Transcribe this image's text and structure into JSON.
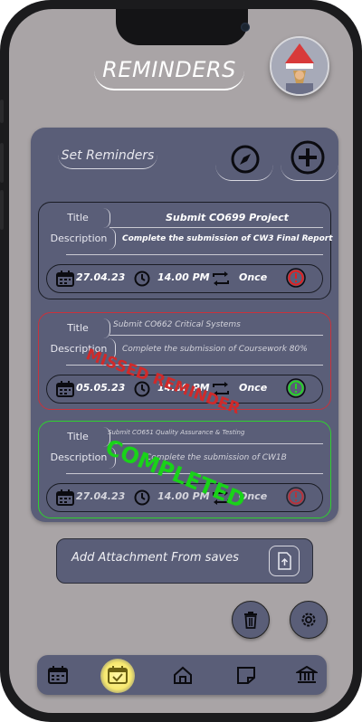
{
  "header": {
    "title": "REMINDERS"
  },
  "panel": {
    "set_reminders_label": "Set Reminders"
  },
  "reminders": [
    {
      "title_label": "Title",
      "description_label": "Description",
      "title": "Submit CO699 Project",
      "description": "Complete the submission of CW3 Final Report",
      "date": "27.04.23",
      "time": "14.00 PM",
      "repeat": "Once",
      "status": "active",
      "border_color": "#1a1c24"
    },
    {
      "title_label": "Title",
      "description_label": "Description",
      "title": "Submit CO662 Critical Systems",
      "description": "Complete the submission of Coursework 80%",
      "date": "05.05.23",
      "time": "14.00 PM",
      "repeat": "Once",
      "status": "missed",
      "stamp": "MISSED REMINDER",
      "border_color": "#c8323c"
    },
    {
      "title_label": "Title",
      "description_label": "Description",
      "title": "Submit CO651 Quality Assurance & Testing",
      "description": "Complete the submission of CW1B",
      "date": "27.04.23",
      "time": "14.00 PM",
      "repeat": "Once",
      "status": "completed",
      "stamp": "COMPLETED",
      "border_color": "#2fd12f"
    }
  ],
  "attachment": {
    "label": "Add Attachment From saves"
  },
  "colors": {
    "background": "#a9a4a6",
    "panel": "#5a5e78",
    "missed": "#d02a2a",
    "completed": "#19d319",
    "nav_active": "#f6e86e"
  },
  "nav": {
    "items": [
      "calendar-icon",
      "calendar-check-icon",
      "home-icon",
      "note-icon",
      "bank-icon"
    ],
    "active_index": 1
  }
}
